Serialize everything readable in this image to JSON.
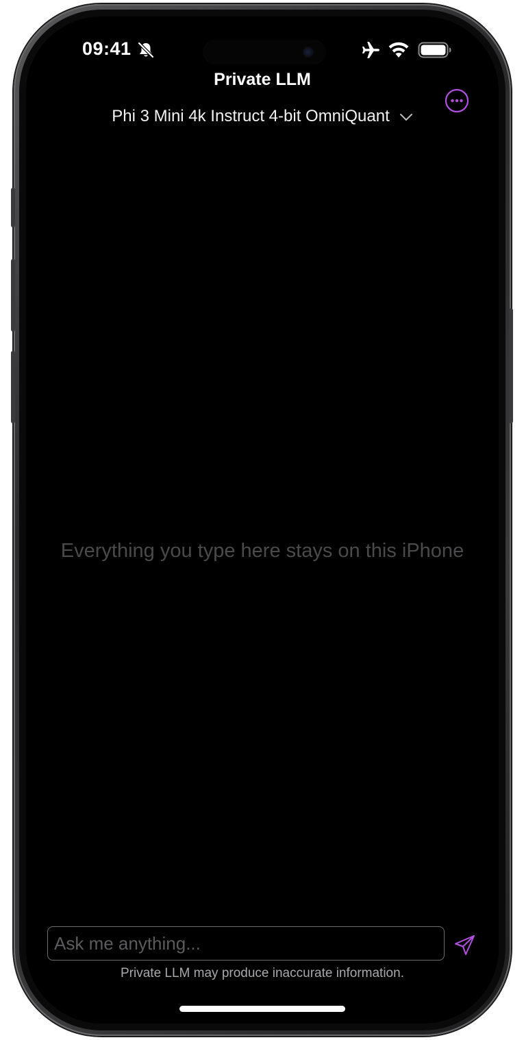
{
  "status_bar": {
    "time": "09:41",
    "icons": [
      "bell-slash-icon",
      "airplane-icon",
      "wifi-icon",
      "battery-icon"
    ]
  },
  "header": {
    "title": "Private LLM",
    "model_selector": {
      "selected": "Phi 3 Mini 4k Instruct 4-bit OmniQuant",
      "icon": "chevron-down-icon"
    },
    "more_button_icon": "ellipsis-circle-icon"
  },
  "chat": {
    "empty_message": "Everything you type here stays on this iPhone"
  },
  "composer": {
    "placeholder": "Ask me anything...",
    "value": "",
    "send_icon": "paper-plane-icon",
    "disclaimer": "Private LLM may produce inaccurate information."
  },
  "colors": {
    "accent": "#b24fe0",
    "background": "#000000",
    "empty_text": "#4a4a4c",
    "disclaimer_text": "#a9a9ad"
  }
}
